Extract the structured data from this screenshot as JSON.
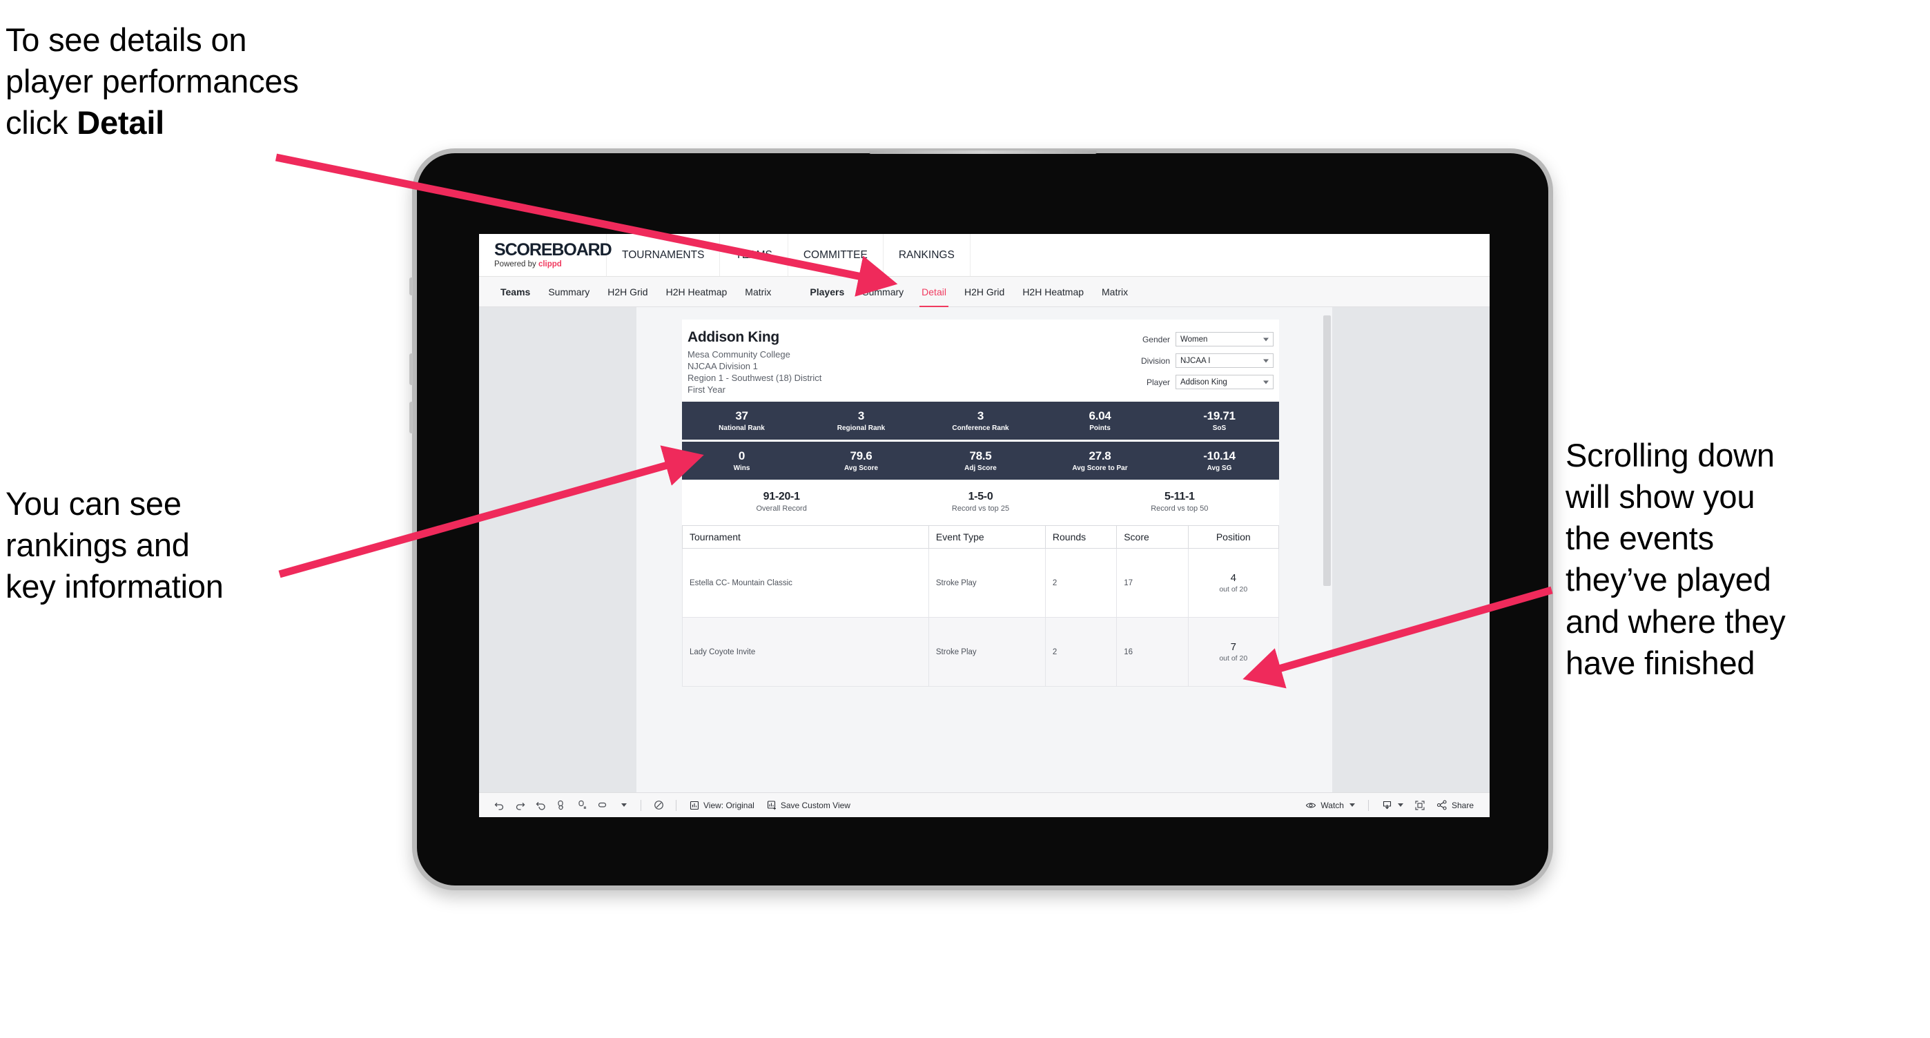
{
  "annotations": {
    "top_left": {
      "line1": "To see details on",
      "line2": "player performances",
      "line3_prefix": "click ",
      "line3_bold": "Detail"
    },
    "left_mid": {
      "line1": "You can see",
      "line2": "rankings and",
      "line3": "key information"
    },
    "right": {
      "line1": "Scrolling down",
      "line2": "will show you",
      "line3": "the events",
      "line4": "they’ve played",
      "line5": "and where they",
      "line6": "have finished"
    }
  },
  "app": {
    "logo": {
      "title": "SCOREBOARD",
      "powered_prefix": "Powered by ",
      "brand": "clippd"
    },
    "main_nav": [
      "TOURNAMENTS",
      "TEAMS",
      "COMMITTEE",
      "RANKINGS"
    ],
    "sub_nav": {
      "teams_group": [
        "Teams",
        "Summary",
        "H2H Grid",
        "H2H Heatmap",
        "Matrix"
      ],
      "players_group": [
        "Players",
        "Summary",
        "Detail",
        "H2H Grid",
        "H2H Heatmap",
        "Matrix"
      ],
      "active": "Detail"
    },
    "player": {
      "name": "Addison King",
      "school": "Mesa Community College",
      "division": "NJCAA Division 1",
      "region": "Region 1 - Southwest (18) District",
      "year": "First Year"
    },
    "filters": [
      {
        "label": "Gender",
        "value": "Women"
      },
      {
        "label": "Division",
        "value": "NJCAA I"
      },
      {
        "label": "Player",
        "value": "Addison King"
      }
    ],
    "stats_row1": [
      {
        "value": "37",
        "label": "National Rank"
      },
      {
        "value": "3",
        "label": "Regional Rank"
      },
      {
        "value": "3",
        "label": "Conference Rank"
      },
      {
        "value": "6.04",
        "label": "Points"
      },
      {
        "value": "-19.71",
        "label": "SoS"
      }
    ],
    "stats_row2": [
      {
        "value": "0",
        "label": "Wins"
      },
      {
        "value": "79.6",
        "label": "Avg Score"
      },
      {
        "value": "78.5",
        "label": "Adj Score"
      },
      {
        "value": "27.8",
        "label": "Avg Score to Par"
      },
      {
        "value": "-10.14",
        "label": "Avg SG"
      }
    ],
    "records": [
      {
        "value": "91-20-1",
        "label": "Overall Record"
      },
      {
        "value": "1-5-0",
        "label": "Record vs top 25"
      },
      {
        "value": "5-11-1",
        "label": "Record vs top 50"
      }
    ],
    "table": {
      "headers": [
        "Tournament",
        "Event Type",
        "Rounds",
        "Score",
        "Position"
      ],
      "rows": [
        {
          "tournament": "Estella CC- Mountain Classic",
          "event_type": "Stroke Play",
          "rounds": "2",
          "score": "17",
          "position": "4",
          "position_of": "out of 20"
        },
        {
          "tournament": "Lady Coyote Invite",
          "event_type": "Stroke Play",
          "rounds": "2",
          "score": "16",
          "position": "7",
          "position_of": "out of 20"
        }
      ]
    },
    "toolbar": {
      "view_label": "View: Original",
      "save_label": "Save Custom View",
      "watch_label": "Watch",
      "share_label": "Share"
    }
  },
  "colors": {
    "accent_pink": "#f03a5f",
    "arrow_pink": "#ef2a5b",
    "stat_navy": "#333b4f"
  }
}
